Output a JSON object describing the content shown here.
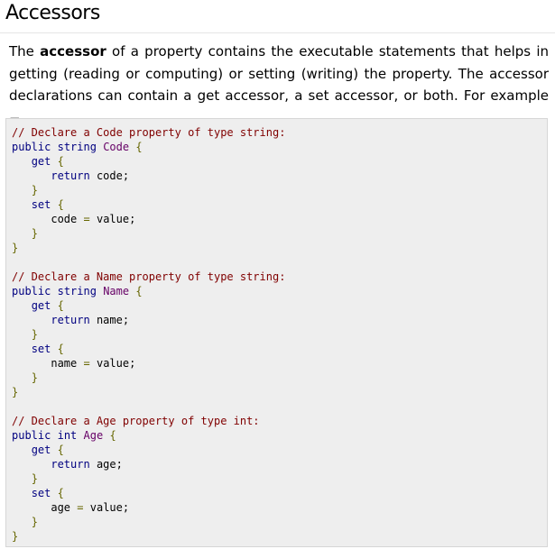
{
  "section": {
    "title": "Accessors",
    "intro": {
      "before_bold": "The ",
      "bold": "accessor",
      "after_bold": " of a property contains the executable statements that helps in getting (reading or computing) or setting (writing) the property. The accessor declarations can contain a get accessor, a set accessor, or both. For example −"
    }
  },
  "code_example": {
    "language": "csharp",
    "lines": [
      "// Declare a Code property of type string:",
      "public string Code {",
      "   get {",
      "      return code;",
      "   }",
      "   set {",
      "      code = value;",
      "   }",
      "}",
      "",
      "// Declare a Name property of type string:",
      "public string Name {",
      "   get {",
      "      return name;",
      "   }",
      "   set {",
      "      name = value;",
      "   }",
      "}",
      "",
      "// Declare a Age property of type int:",
      "public int Age {",
      "   get {",
      "      return age;",
      "   }",
      "   set {",
      "      age = value;",
      "   }",
      "}"
    ],
    "colors": {
      "background": "#eeeeee",
      "comment": "#800000",
      "keyword": "#000080",
      "identifier": "#660066",
      "punctuation": "#666600"
    }
  }
}
